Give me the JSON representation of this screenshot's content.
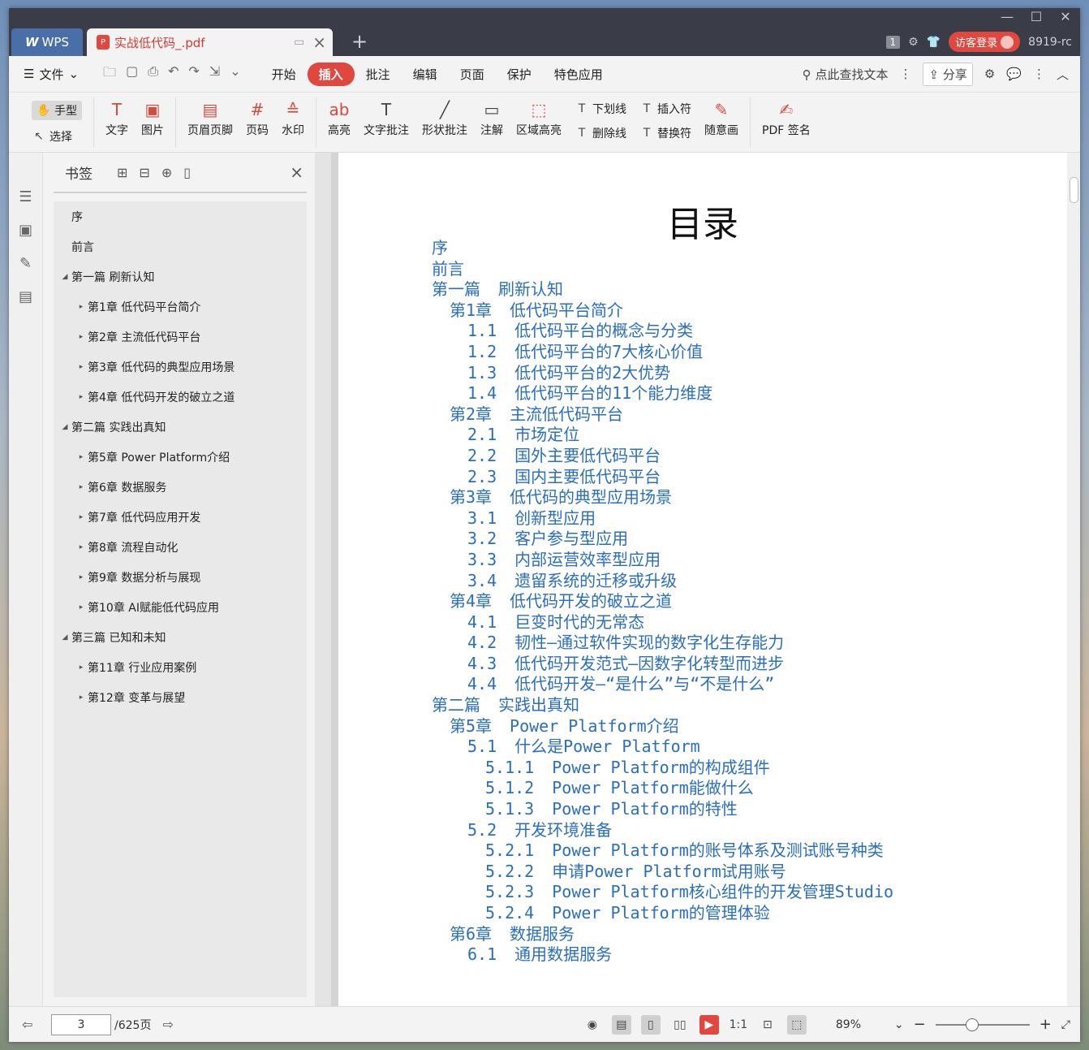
{
  "titlebar": {
    "app_tab": "WPS",
    "doc_tab": "实战低代码_.pdf",
    "new_tab": "+",
    "badge": "1",
    "login": "访客登录",
    "version": "8919-rc"
  },
  "menubar": {
    "file": "文件",
    "tabs": [
      "开始",
      "插入",
      "批注",
      "编辑",
      "页面",
      "保护",
      "特色应用"
    ],
    "active_tab": "插入",
    "search": "点此查找文本",
    "share": "分享"
  },
  "ribbon": {
    "hand": "手型",
    "select": "选择",
    "text": "文字",
    "image": "图片",
    "header_footer": "页眉页脚",
    "page_num": "页码",
    "watermark": "水印",
    "highlight": "高亮",
    "text_annot": "文字批注",
    "shape_annot": "形状批注",
    "note": "注解",
    "area_highlight": "区域高亮",
    "underline": "下划线",
    "strikethrough": "删除线",
    "insert_mark": "插入符",
    "replace_mark": "替换符",
    "freehand": "随意画",
    "pdf_sign": "PDF 签名"
  },
  "bookmarks": {
    "title": "书签",
    "items": [
      {
        "label": "序",
        "level": "plain"
      },
      {
        "label": "前言",
        "level": "plain"
      },
      {
        "label": "第一篇 刷新认知",
        "level": "l0"
      },
      {
        "label": "第1章 低代码平台简介",
        "level": "l1"
      },
      {
        "label": "第2章 主流低代码平台",
        "level": "l1"
      },
      {
        "label": "第3章 低代码的典型应用场景",
        "level": "l1"
      },
      {
        "label": "第4章 低代码开发的破立之道",
        "level": "l1"
      },
      {
        "label": "第二篇 实践出真知",
        "level": "l0"
      },
      {
        "label": "第5章 Power Platform介绍",
        "level": "l1"
      },
      {
        "label": "第6章 数据服务",
        "level": "l1"
      },
      {
        "label": "第7章 低代码应用开发",
        "level": "l1"
      },
      {
        "label": "第8章 流程自动化",
        "level": "l1"
      },
      {
        "label": "第9章 数据分析与展现",
        "level": "l1"
      },
      {
        "label": "第10章 AI赋能低代码应用",
        "level": "l1"
      },
      {
        "label": "第三篇 已知和未知",
        "level": "l0"
      },
      {
        "label": "第11章 行业应用案例",
        "level": "l1"
      },
      {
        "label": "第12章 变革与展望",
        "level": "l1"
      }
    ]
  },
  "document": {
    "title": "目录",
    "toc": [
      {
        "num": "",
        "text": "序",
        "indent": 0
      },
      {
        "num": "",
        "text": "前言",
        "indent": 0
      },
      {
        "num": "第一篇",
        "text": "刷新认知",
        "indent": 0
      },
      {
        "num": "第1章",
        "text": "低代码平台简介",
        "indent": 1
      },
      {
        "num": "1.1",
        "text": "低代码平台的概念与分类",
        "indent": 2
      },
      {
        "num": "1.2",
        "text": "低代码平台的7大核心价值",
        "indent": 2
      },
      {
        "num": "1.3",
        "text": "低代码平台的2大优势",
        "indent": 2
      },
      {
        "num": "1.4",
        "text": "低代码平台的11个能力维度",
        "indent": 2
      },
      {
        "num": "第2章",
        "text": "主流低代码平台",
        "indent": 1
      },
      {
        "num": "2.1",
        "text": "市场定位",
        "indent": 2
      },
      {
        "num": "2.2",
        "text": "国外主要低代码平台",
        "indent": 2
      },
      {
        "num": "2.3",
        "text": "国内主要低代码平台",
        "indent": 2
      },
      {
        "num": "第3章",
        "text": "低代码的典型应用场景",
        "indent": 1
      },
      {
        "num": "3.1",
        "text": "创新型应用",
        "indent": 2
      },
      {
        "num": "3.2",
        "text": "客户参与型应用",
        "indent": 2
      },
      {
        "num": "3.3",
        "text": "内部运营效率型应用",
        "indent": 2
      },
      {
        "num": "3.4",
        "text": "遗留系统的迁移或升级",
        "indent": 2
      },
      {
        "num": "第4章",
        "text": "低代码开发的破立之道",
        "indent": 1
      },
      {
        "num": "4.1",
        "text": "巨变时代的无常态",
        "indent": 2
      },
      {
        "num": "4.2",
        "text": "韧性—通过软件实现的数字化生存能力",
        "indent": 2
      },
      {
        "num": "4.3",
        "text": "低代码开发范式—因数字化转型而进步",
        "indent": 2
      },
      {
        "num": "4.4",
        "text": "低代码开发—“是什么”与“不是什么”",
        "indent": 2
      },
      {
        "num": "第二篇",
        "text": "实践出真知",
        "indent": 0
      },
      {
        "num": "第5章",
        "text": "Power  Platform介绍",
        "indent": 1
      },
      {
        "num": "5.1",
        "text": "什么是Power  Platform",
        "indent": 2
      },
      {
        "num": "5.1.1",
        "text": "Power  Platform的构成组件",
        "indent": 3
      },
      {
        "num": "5.1.2",
        "text": "Power  Platform能做什么",
        "indent": 3
      },
      {
        "num": "5.1.3",
        "text": "Power  Platform的特性",
        "indent": 3
      },
      {
        "num": "5.2",
        "text": "开发环境准备",
        "indent": 2
      },
      {
        "num": "5.2.1",
        "text": "Power  Platform的账号体系及测试账号种类",
        "indent": 3
      },
      {
        "num": "5.2.2",
        "text": "申请Power  Platform试用账号",
        "indent": 3
      },
      {
        "num": "5.2.3",
        "text": "Power  Platform核心组件的开发管理Studio",
        "indent": 3
      },
      {
        "num": "5.2.4",
        "text": "Power  Platform的管理体验",
        "indent": 3
      },
      {
        "num": "第6章",
        "text": "数据服务",
        "indent": 1
      },
      {
        "num": "6.1",
        "text": "通用数据服务",
        "indent": 2
      }
    ]
  },
  "statusbar": {
    "page_current": "3",
    "page_total": "/625页",
    "zoom": "89%",
    "zoom_level": 0.39
  }
}
